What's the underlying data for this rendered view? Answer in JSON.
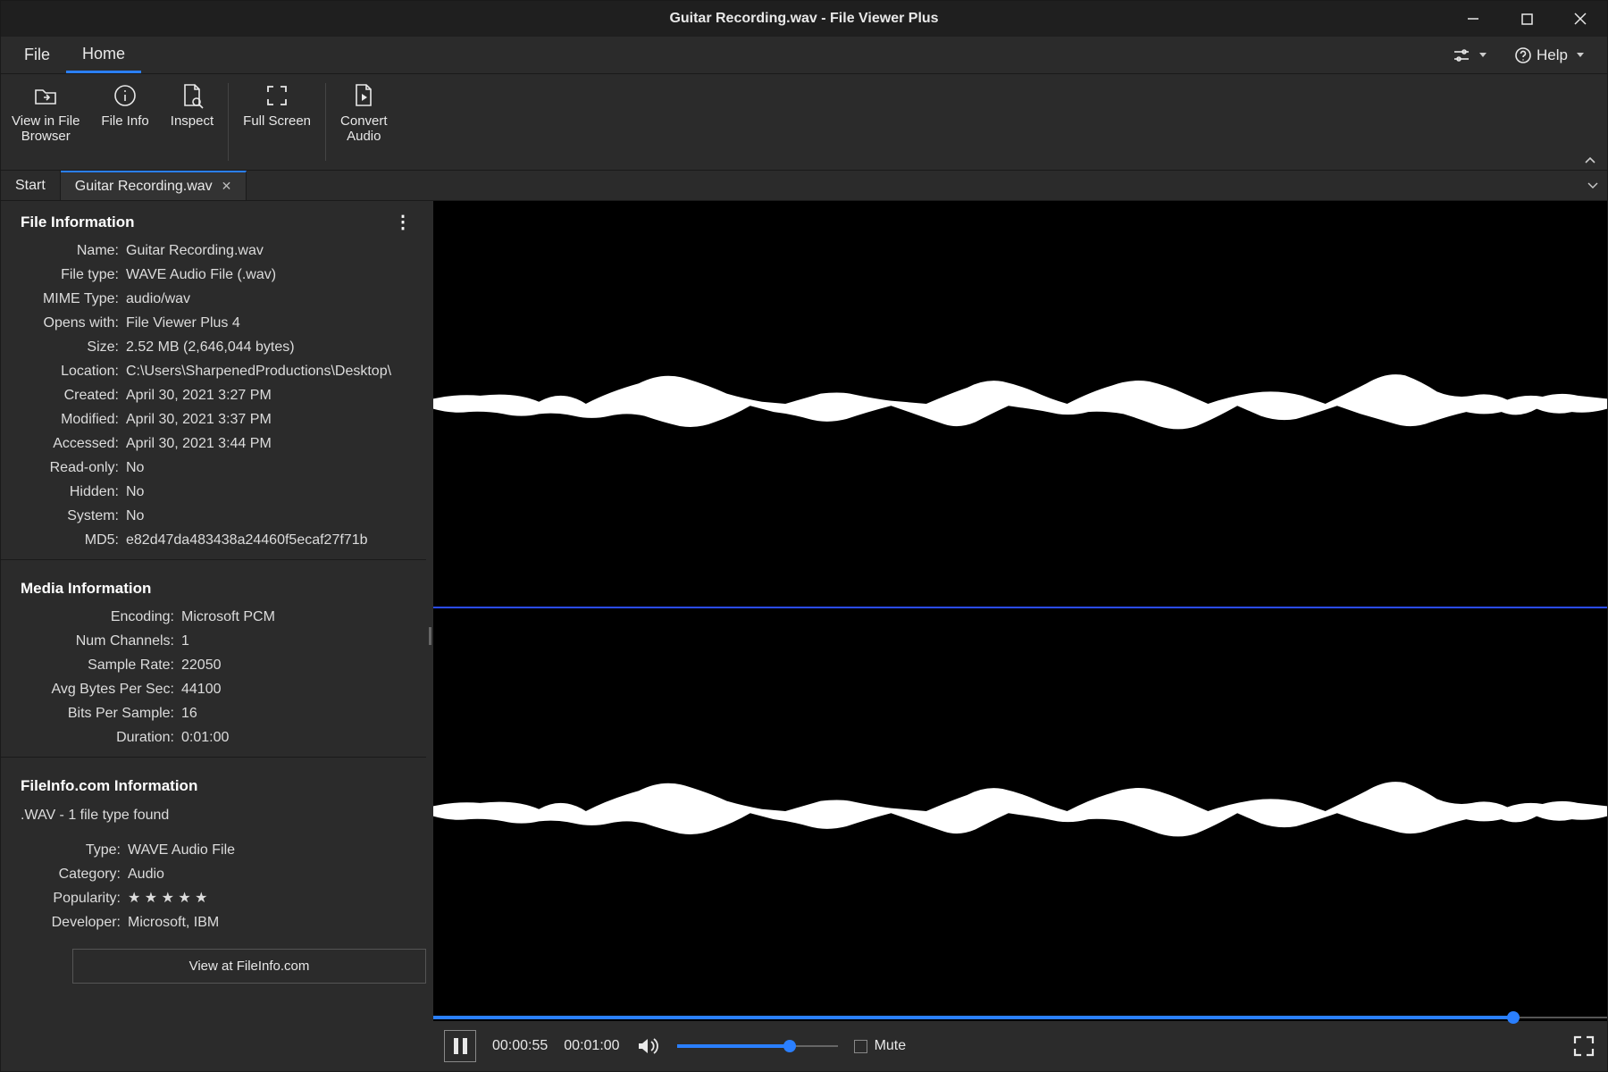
{
  "window": {
    "title": "Guitar Recording.wav - File Viewer Plus"
  },
  "menubar": {
    "file_label": "File",
    "home_label": "Home",
    "help_label": "Help"
  },
  "ribbon": {
    "view_in_browser": "View in File\nBrowser",
    "file_info": "File Info",
    "inspect": "Inspect",
    "full_screen": "Full Screen",
    "convert_audio": "Convert\nAudio"
  },
  "tabs": {
    "start": "Start",
    "current": "Guitar Recording.wav"
  },
  "sidebar": {
    "file_info_header": "File Information",
    "items": {
      "name": {
        "k": "Name:",
        "v": "Guitar Recording.wav"
      },
      "file_type": {
        "k": "File type:",
        "v": "WAVE Audio File (.wav)"
      },
      "mime": {
        "k": "MIME Type:",
        "v": "audio/wav"
      },
      "opens_with": {
        "k": "Opens with:",
        "v": "File Viewer Plus 4"
      },
      "size": {
        "k": "Size:",
        "v": "2.52 MB (2,646,044 bytes)"
      },
      "location": {
        "k": "Location:",
        "v": "C:\\Users\\SharpenedProductions\\Desktop\\"
      },
      "created": {
        "k": "Created:",
        "v": "April 30, 2021 3:27 PM"
      },
      "modified": {
        "k": "Modified:",
        "v": "April 30, 2021 3:37 PM"
      },
      "accessed": {
        "k": "Accessed:",
        "v": "April 30, 2021 3:44 PM"
      },
      "readonly": {
        "k": "Read-only:",
        "v": "No"
      },
      "hidden": {
        "k": "Hidden:",
        "v": "No"
      },
      "system": {
        "k": "System:",
        "v": "No"
      },
      "md5": {
        "k": "MD5:",
        "v": "e82d47da483438a24460f5ecaf27f71b"
      }
    },
    "media_header": "Media Information",
    "media": {
      "encoding": {
        "k": "Encoding:",
        "v": "Microsoft PCM"
      },
      "channels": {
        "k": "Num Channels:",
        "v": "1"
      },
      "sample_rate": {
        "k": "Sample Rate:",
        "v": "22050"
      },
      "avg_bps": {
        "k": "Avg Bytes Per Sec:",
        "v": "44100"
      },
      "bits_sample": {
        "k": "Bits Per Sample:",
        "v": "16"
      },
      "duration": {
        "k": "Duration:",
        "v": "0:01:00"
      }
    },
    "fileinfo_header": "FileInfo.com Information",
    "fileinfo_line": ".WAV - 1 file type found",
    "fileinfo": {
      "type": {
        "k": "Type:",
        "v": "WAVE Audio File"
      },
      "category": {
        "k": "Category:",
        "v": "Audio"
      },
      "popularity": {
        "k": "Popularity:",
        "v": "★ ★ ★ ★ ★"
      },
      "developer": {
        "k": "Developer:",
        "v": "Microsoft, IBM"
      }
    },
    "view_fileinfo_btn": "View at FileInfo.com"
  },
  "player": {
    "current_time": "00:00:55",
    "total_time": "00:01:00",
    "mute_label": "Mute",
    "progress_pct": 92,
    "volume_pct": 70
  },
  "colors": {
    "accent": "#2a7fff",
    "bg": "#2b2b2b",
    "dark": "#1f1f1f"
  }
}
